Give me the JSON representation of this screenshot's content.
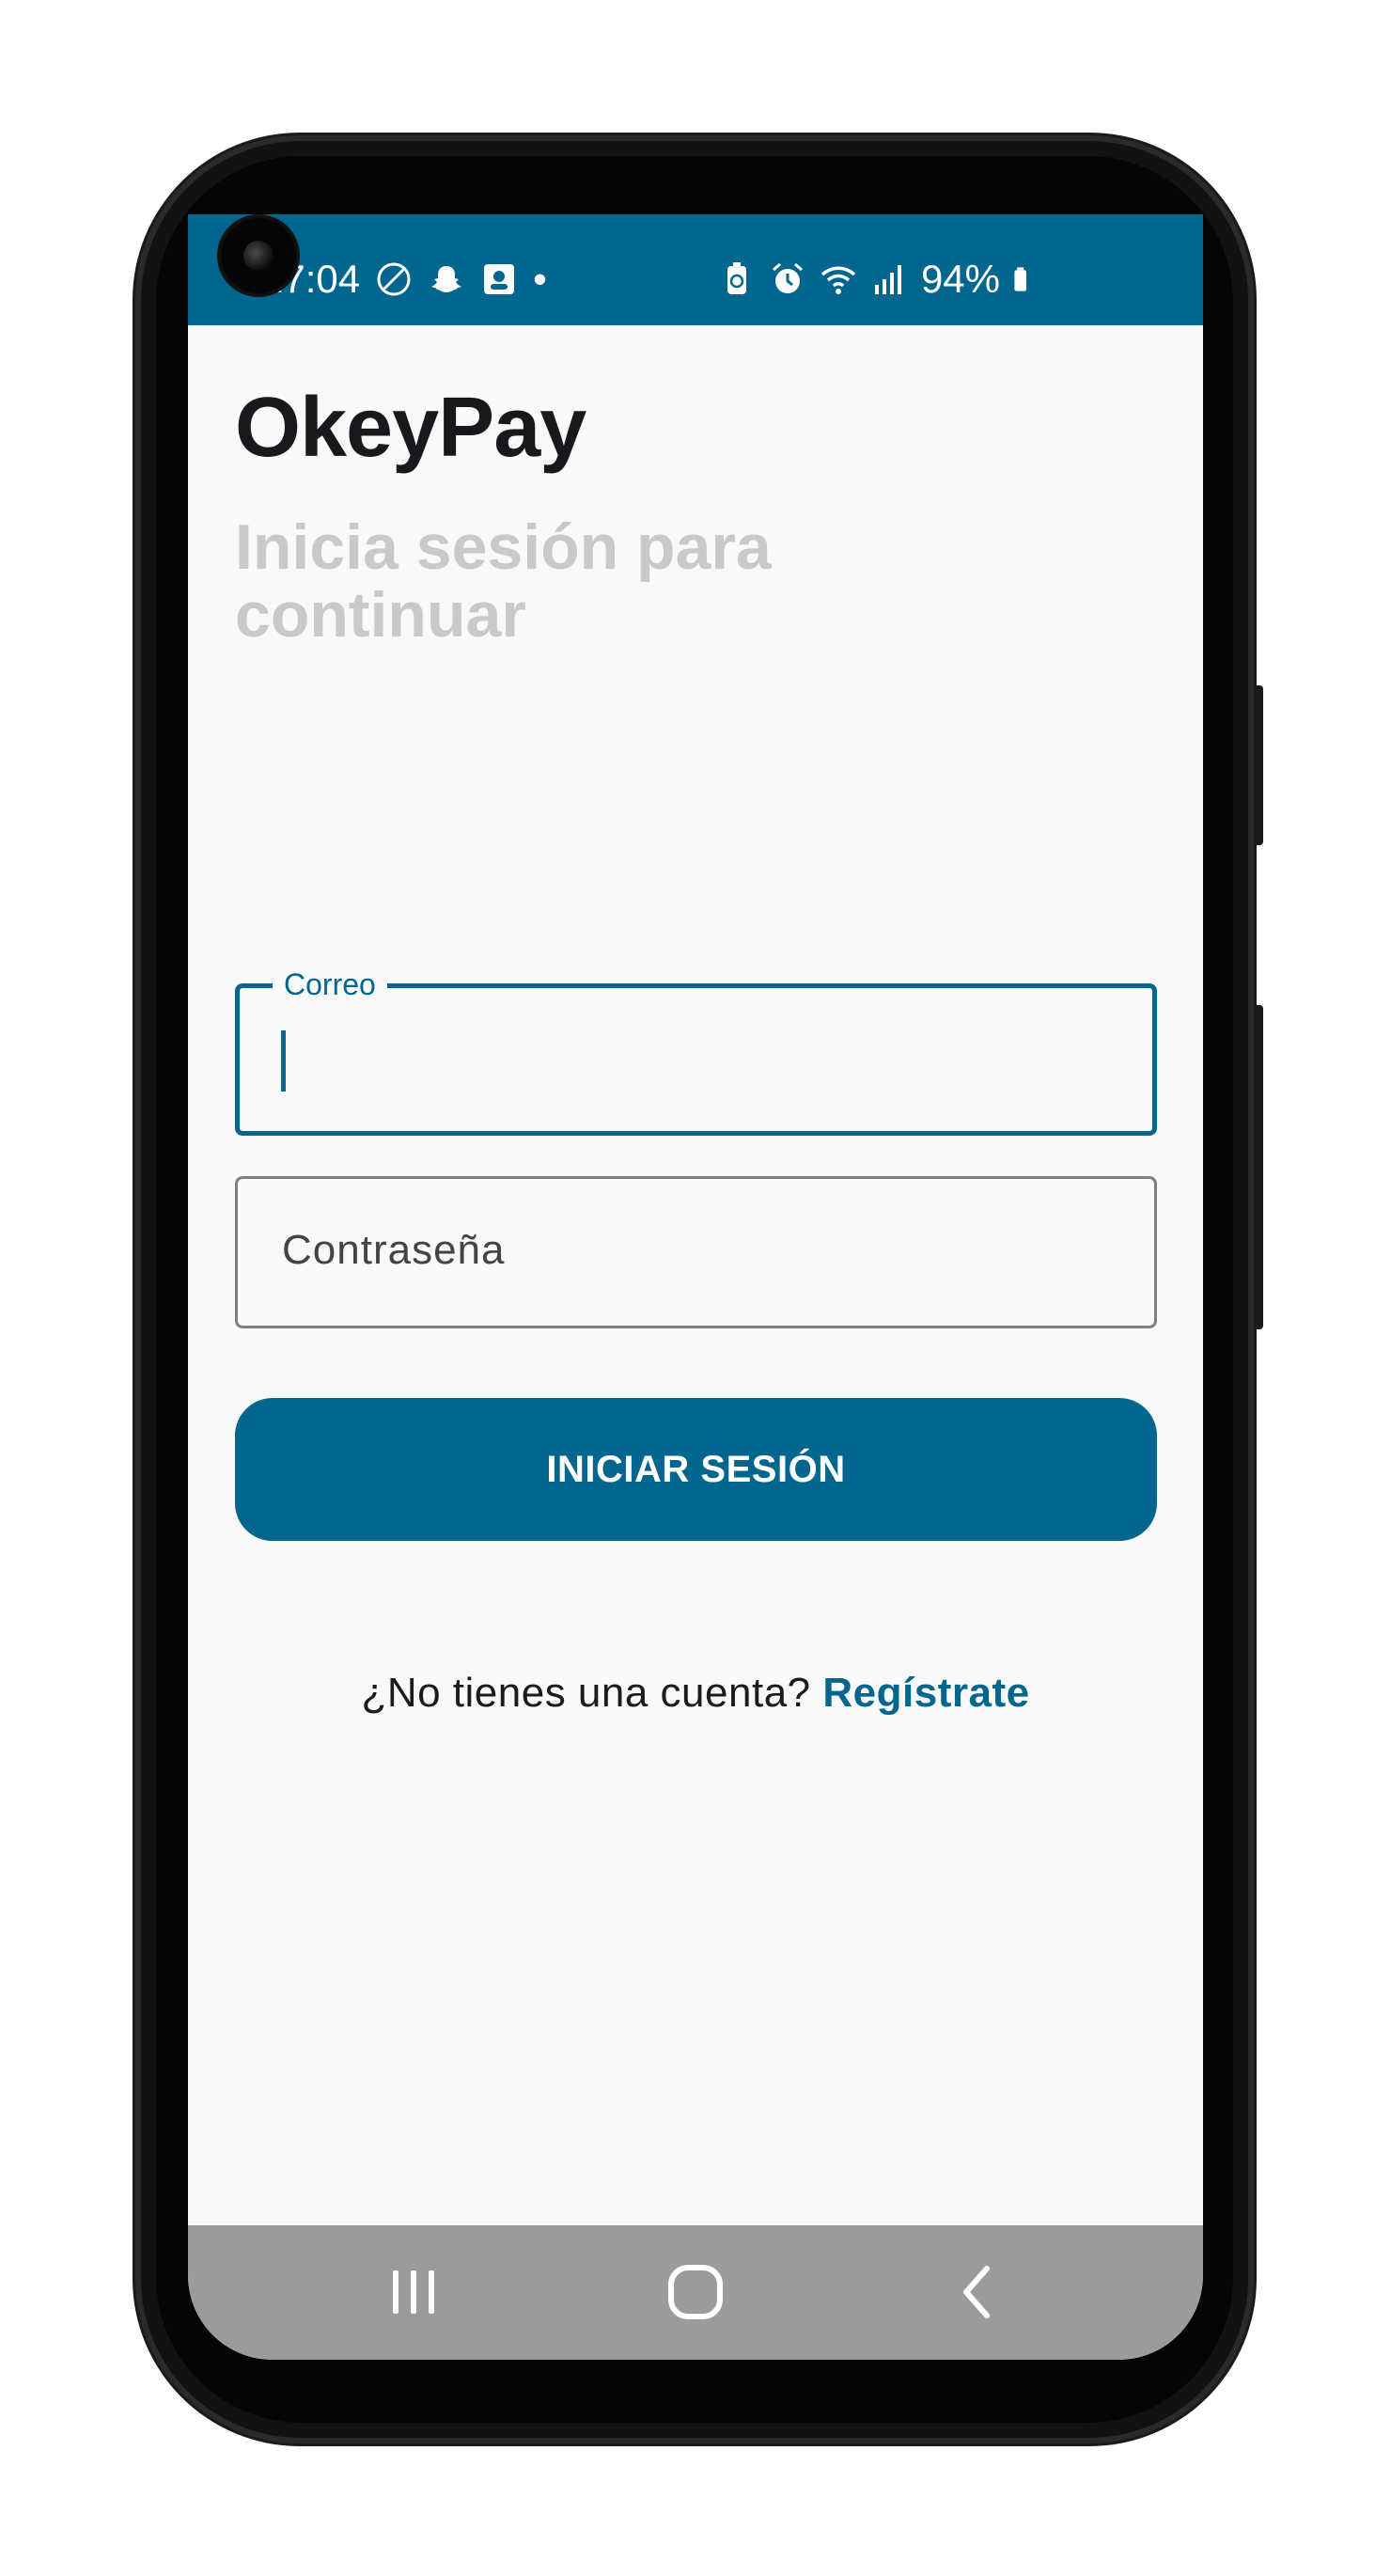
{
  "status_bar": {
    "time": "17:04",
    "left_icons": [
      "do-not-disturb-icon",
      "snapchat-icon",
      "contact-card-icon"
    ],
    "dot": "•",
    "right_icons": [
      "battery-saver-icon",
      "alarm-icon",
      "wifi-icon",
      "signal-icon"
    ],
    "battery": "94%"
  },
  "app": {
    "title": "OkeyPay",
    "subtitle": "Inicia sesión para continuar"
  },
  "form": {
    "email_label": "Correo",
    "email_value": "",
    "password_placeholder": "Contraseña",
    "submit_label": "INICIAR SESIÓN"
  },
  "signup": {
    "prompt": "¿No tienes una cuenta? ",
    "link": "Regístrate"
  },
  "nav_bar": {
    "buttons": [
      "recents-icon",
      "home-icon",
      "back-icon"
    ]
  },
  "colors": {
    "primary": "#02668e",
    "background": "#f9f9fa",
    "subtitle": "#c9c9c9",
    "navbar": "#9b9b9b"
  }
}
